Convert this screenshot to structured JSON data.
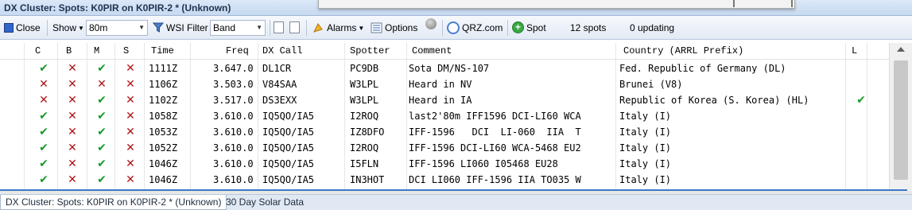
{
  "window": {
    "title": "DX Cluster: Spots: K0PIR on K0PIR-2 * (Unknown)"
  },
  "toolbar": {
    "close_label": "Close",
    "show_label": "Show",
    "band_value": "80m",
    "wsi_filter_label": "WSI Filter",
    "filter_value": "Band",
    "alarms_label": "Alarms",
    "options_label": "Options",
    "qrz_label": "QRZ.com",
    "spot_label": "Spot",
    "spots_count": "12 spots",
    "updating_count": "0 updating"
  },
  "columns": {
    "c": "C",
    "b": "B",
    "m": "M",
    "s": "S",
    "time": "Time",
    "freq": "Freq",
    "dxcall": "DX Call",
    "spotter": "Spotter",
    "comment": "Comment",
    "country": "Country (ARRL Prefix)",
    "l": "L"
  },
  "rows": [
    {
      "c": "yes",
      "b": "no",
      "m": "yes",
      "s": "no",
      "time": "1111Z",
      "freq": "3.647.0",
      "dxcall": "DL1CR",
      "spotter": "PC9DB",
      "comment": "Sota DM/NS-107",
      "country": "Fed. Republic of Germany (DL)",
      "l": ""
    },
    {
      "c": "no",
      "b": "no",
      "m": "no",
      "s": "no",
      "time": "1106Z",
      "freq": "3.503.0",
      "dxcall": "V84SAA",
      "spotter": "W3LPL",
      "comment": "Heard in NV",
      "country": "Brunei (V8)",
      "l": ""
    },
    {
      "c": "no",
      "b": "no",
      "m": "yes",
      "s": "no",
      "time": "1102Z",
      "freq": "3.517.0",
      "dxcall": "DS3EXX",
      "spotter": "W3LPL",
      "comment": "Heard in IA",
      "country": "Republic of Korea (S. Korea) (HL)",
      "l": "yes"
    },
    {
      "c": "yes",
      "b": "no",
      "m": "yes",
      "s": "no",
      "time": "1058Z",
      "freq": "3.610.0",
      "dxcall": "IQ5QO/IA5",
      "spotter": "I2ROQ",
      "comment": "last2'80m IFF1596 DCI-LI60 WCA",
      "country": "Italy (I)",
      "l": ""
    },
    {
      "c": "yes",
      "b": "no",
      "m": "yes",
      "s": "no",
      "time": "1053Z",
      "freq": "3.610.0",
      "dxcall": "IQ5QO/IA5",
      "spotter": "IZ8DFO",
      "comment": "IFF-1596   DCI  LI-060  IIA  T",
      "country": "Italy (I)",
      "l": ""
    },
    {
      "c": "yes",
      "b": "no",
      "m": "yes",
      "s": "no",
      "time": "1052Z",
      "freq": "3.610.0",
      "dxcall": "IQ5QO/IA5",
      "spotter": "I2ROQ",
      "comment": "IFF-1596 DCI-LI60 WCA-5468 EU2",
      "country": "Italy (I)",
      "l": ""
    },
    {
      "c": "yes",
      "b": "no",
      "m": "yes",
      "s": "no",
      "time": "1046Z",
      "freq": "3.610.0",
      "dxcall": "IQ5QO/IA5",
      "spotter": "I5FLN",
      "comment": "IFF-1596 LI060 I05468 EU28",
      "country": "Italy (I)",
      "l": ""
    },
    {
      "c": "yes",
      "b": "no",
      "m": "yes",
      "s": "no",
      "time": "1046Z",
      "freq": "3.610.0",
      "dxcall": "IQ5QO/IA5",
      "spotter": "IN3HOT",
      "comment": "DCI LI060 IFF-1596 IIA TO035 W",
      "country": "Italy (I)",
      "l": ""
    }
  ],
  "tabs": [
    {
      "label": "DX Cluster: Spots: K0PIR on K0PIR-2 * (Unknown)"
    },
    {
      "label": "30 Day Solar Data"
    }
  ],
  "colors": {
    "check": "#1a9a2a",
    "cross": "#b0121b",
    "accent": "#3a78c8"
  }
}
